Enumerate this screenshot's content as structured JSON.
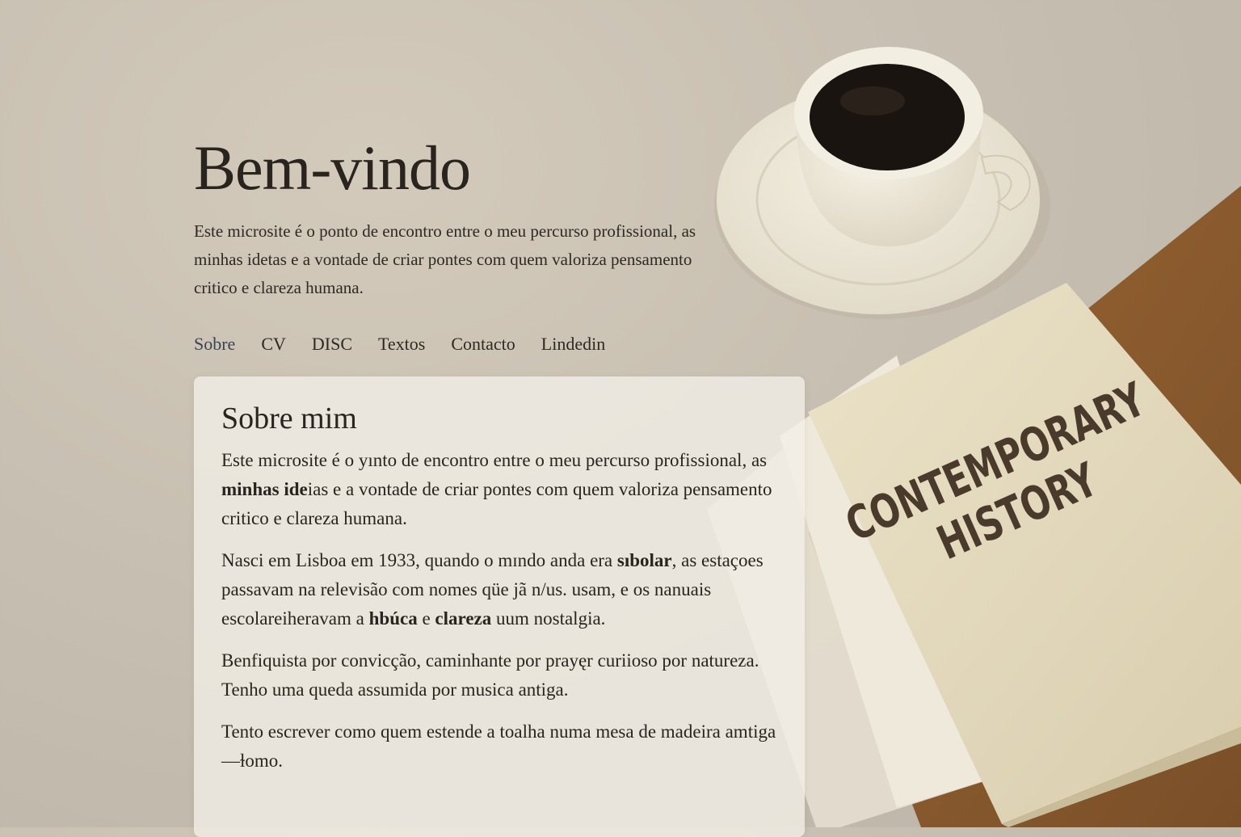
{
  "hero": {
    "title": "Bem-vindo",
    "intro": "Este microsite é o ponto de encontro entre o meu percurso profissional, as minhas idetas e a vontade de criar pontes com quem valoriza pensamento critico e clareza humana."
  },
  "nav": {
    "items": [
      {
        "label": "Sobre",
        "active": true
      },
      {
        "label": "CV"
      },
      {
        "label": "DISC"
      },
      {
        "label": "Textos"
      },
      {
        "label": "Contacto"
      },
      {
        "label": "Lindedin"
      }
    ]
  },
  "about": {
    "heading": "Sobre mim",
    "p1": {
      "a": "Este microsite é o yınto de encontro entre o meu percurso profissional, as ",
      "b": "minhas ide",
      "c": "ias e a vontade de criar pontes com quem valoriza pensamento critico e clareza humana."
    },
    "p2": {
      "a": "Nasci em Lisboa em 1933, quando o mɪndo anda era ",
      "b": "sıbolar",
      "c": ", as estaçoes passavam na relevisão com nomes qüe jã n/us. usam, e os nanuais escolareiheravam a ",
      "d": "hbúca",
      "e": " e ",
      "f": "clareza",
      "g": " uum nostalgia."
    },
    "p3": "Benfiquista por convicção, caminhante por prayęr  curiioso por natureza. Tenho uma queda assumida por musica antiga.",
    "p4": "Tento escrever como quem estende a toalha numa mesa de madeira amtiga—ɫomo."
  },
  "book": {
    "title_line1": "CONTEMPORARY",
    "title_line2": "HISTORY"
  },
  "colors": {
    "background": "#c7bfb1",
    "card": "#f4f0e8",
    "text": "#2a241e",
    "book_cover": "#e3d8bd",
    "book_board": "#8a5a2e",
    "coffee": "#1a1410"
  }
}
